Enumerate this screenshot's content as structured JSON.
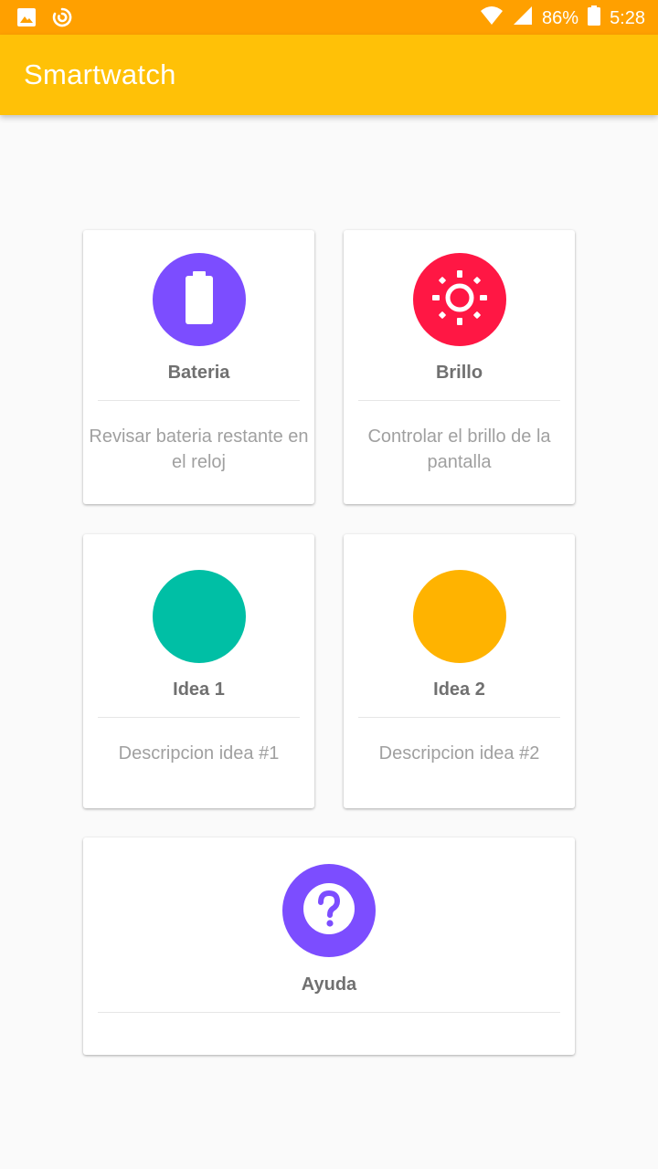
{
  "status_bar": {
    "battery": "86%",
    "time": "5:28",
    "icons": [
      "image-icon",
      "sync-icon",
      "wifi-icon",
      "signal-icon",
      "battery-icon"
    ]
  },
  "app_bar": {
    "title": "Smartwatch"
  },
  "colors": {
    "status_bar": "#ffa000",
    "app_bar": "#ffc107",
    "battery_circle": "#7c4dff",
    "brightness_circle": "#ff1744",
    "idea1_circle": "#00bfa5",
    "idea2_circle": "#ffb300",
    "help_circle": "#7c4dff"
  },
  "cards": [
    {
      "id": "bateria",
      "title": "Bateria",
      "description": "Revisar bateria restante en el reloj",
      "icon": "battery-icon"
    },
    {
      "id": "brillo",
      "title": "Brillo",
      "description": "Controlar el brillo de la pantalla",
      "icon": "brightness-icon"
    },
    {
      "id": "idea1",
      "title": "Idea 1",
      "description": "Descripcion idea #1",
      "icon": ""
    },
    {
      "id": "idea2",
      "title": "Idea 2",
      "description": "Descripcion idea #2",
      "icon": ""
    },
    {
      "id": "ayuda",
      "title": "Ayuda",
      "description": "",
      "icon": "help-icon"
    }
  ]
}
